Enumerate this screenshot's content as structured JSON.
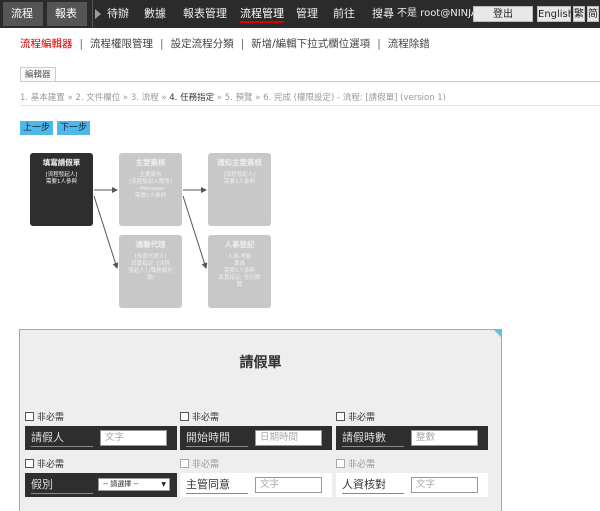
{
  "topbar": {
    "flow_dropdown": "流程",
    "report_dropdown": "報表",
    "items": [
      "待辦",
      "數據",
      "報表管理",
      "流程管理",
      "管理",
      "前往",
      "搜尋"
    ],
    "user": "不是 root@NINJA? ○",
    "logout": "登出",
    "lang_en": "English",
    "lang_tc": "繁",
    "lang_sc": "简"
  },
  "subnav": {
    "items": [
      "流程編輯器",
      "流程權限管理",
      "設定流程分類",
      "新增/編輯下拉式欄位選項",
      "流程除錯"
    ]
  },
  "editor": {
    "tab": "編輯器",
    "steps": [
      "1. 基本建置 »",
      "2. 文件欄位 »",
      "3. 流程 »",
      "4. 任務指定",
      "» 5. 預覽 »",
      "6. 完成 (權限設定) - 流程: [請假單] (version 1)"
    ],
    "prev": "上一步",
    "next": "下一步"
  },
  "flow": {
    "nodes": [
      {
        "title": "填寫請假單",
        "desc": [
          "[流程發起人]",
          "需要1人參與"
        ]
      },
      {
        "title": "主要簽核",
        "desc": [
          "主要簽核",
          "[流程發起人職等]",
          "- Manager",
          "需要1人參與"
        ]
      },
      {
        "title": "通知主要簽核",
        "desc": [
          "[流程發起人]",
          "需要1人參與"
        ]
      },
      {
        "title": "通聯代理",
        "desc": [
          "[休假代理人]",
          "真實指定: [流程",
          "發起人] (職務類別",
          "導)"
        ]
      },
      {
        "title": "人事登記",
        "desc": [
          "人事-考勤",
          "專員",
          "需要1人參與",
          "真實指定: 任何群",
          "體"
        ]
      }
    ]
  },
  "form": {
    "title": "請假單",
    "fields": [
      {
        "required": "非必需",
        "label": "請假人",
        "placeholder": "文字"
      },
      {
        "required": "非必需",
        "label": "開始時間",
        "placeholder": "日期時間"
      },
      {
        "required": "非必需",
        "label": "請假時數",
        "placeholder": "整數"
      },
      {
        "required": "非必需",
        "label": "假別",
        "select": "-- 請選擇 --"
      },
      {
        "required": "非必需",
        "label": "主管同意",
        "placeholder": "文字"
      },
      {
        "required": "非必需",
        "label": "人資核對",
        "placeholder": "文字"
      }
    ]
  }
}
